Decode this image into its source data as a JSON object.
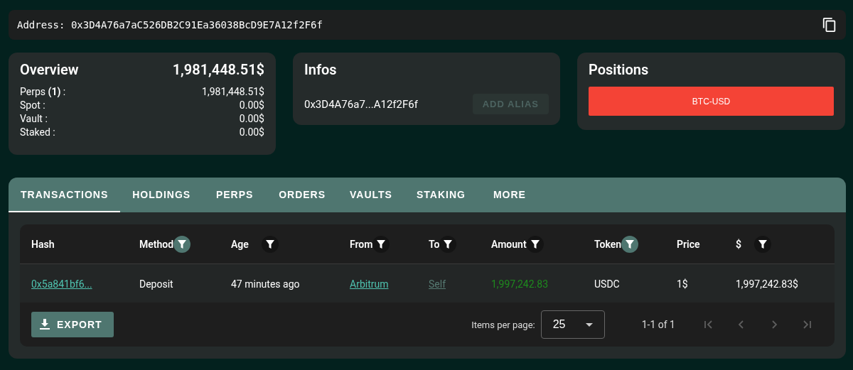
{
  "address_bar": {
    "label": "Address:",
    "value": "0x3D4A76a7aC526DB2C91Ea36038BcD9E7A12f2F6f"
  },
  "overview": {
    "title": "Overview",
    "total": "1,981,448.51$",
    "rows": [
      {
        "label": "Perps **(1)** :",
        "value": "1,981,448.51$"
      },
      {
        "label": "Spot :",
        "value": "0.00$"
      },
      {
        "label": "Vault :",
        "value": "0.00$"
      },
      {
        "label": "Staked :",
        "value": "0.00$"
      }
    ]
  },
  "infos": {
    "title": "Infos",
    "address": "0x3D4A76a7...A12f2F6f",
    "button": {
      "label": "ADD ALIAS",
      "disabled": true
    }
  },
  "positions": {
    "title": "Positions",
    "items": [
      {
        "label": "BTC-USD",
        "color": "#f44336"
      }
    ]
  },
  "tabs": [
    {
      "label": "TRANSACTIONS",
      "selected": true
    },
    {
      "label": "HOLDINGS",
      "selected": false
    },
    {
      "label": "PERPS",
      "selected": false
    },
    {
      "label": "ORDERS",
      "selected": false
    },
    {
      "label": "VAULTS",
      "selected": false
    },
    {
      "label": "STAKING",
      "selected": false
    },
    {
      "label": "MORE",
      "selected": false
    }
  ],
  "table": {
    "columns": [
      {
        "label": "Hash",
        "filter": false,
        "filter_active": false
      },
      {
        "label": "Method",
        "filter": true,
        "filter_active": true
      },
      {
        "label": "Age",
        "filter": true,
        "filter_active": false
      },
      {
        "label": "From",
        "filter": true,
        "filter_active": false
      },
      {
        "label": "To",
        "filter": true,
        "filter_active": false
      },
      {
        "label": "Amount",
        "filter": true,
        "filter_active": false
      },
      {
        "label": "Token",
        "filter": true,
        "filter_active": true
      },
      {
        "label": "Price",
        "filter": false,
        "filter_active": false
      },
      {
        "label": "$",
        "filter": true,
        "filter_active": false
      }
    ],
    "rows": [
      {
        "cells": [
          {
            "text": "0x5a841bf6...",
            "kind": "link"
          },
          {
            "text": "Deposit",
            "kind": "text"
          },
          {
            "text": "47 minutes ago",
            "kind": "text"
          },
          {
            "text": "Arbitrum",
            "kind": "link"
          },
          {
            "text": "Self",
            "kind": "muted-link"
          },
          {
            "text": "1,997,242.83",
            "kind": "positive"
          },
          {
            "text": "USDC",
            "kind": "text"
          },
          {
            "text": "1$",
            "kind": "text"
          },
          {
            "text": "1,997,242.83$",
            "kind": "text"
          }
        ]
      }
    ]
  },
  "export_button": {
    "label": "EXPORT"
  },
  "pagination": {
    "label": "Items per page:",
    "page_size": "25",
    "range": "1-1 of 1",
    "buttons": [
      {
        "kind": "first",
        "disabled": true
      },
      {
        "kind": "prev",
        "disabled": true
      },
      {
        "kind": "next",
        "disabled": true
      },
      {
        "kind": "last",
        "disabled": true
      }
    ]
  }
}
